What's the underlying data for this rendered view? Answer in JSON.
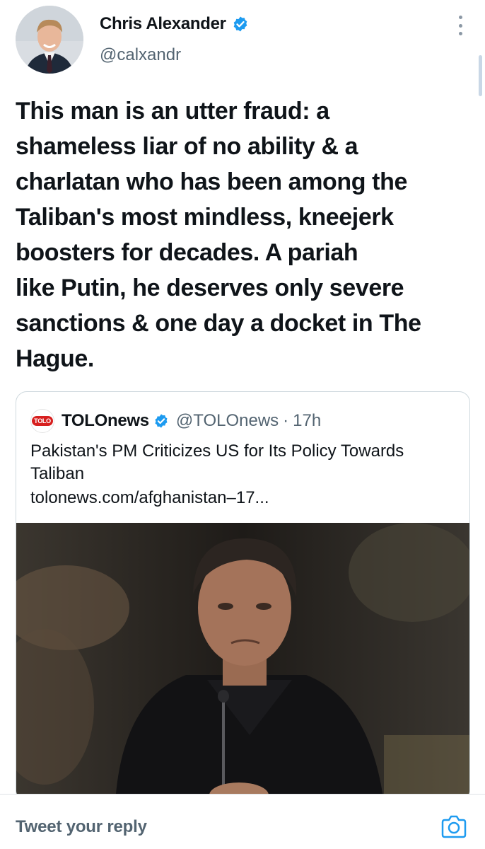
{
  "author": {
    "display_name": "Chris Alexander",
    "handle": "@calxandr"
  },
  "tweet": {
    "lines": [
      "This man is an utter fraud: a",
      "shameless liar of no ability & a",
      "charlatan who has been among the",
      "Taliban's most mindless, kneejerk",
      "boosters for decades. A pariah",
      "like Putin, he deserves only severe",
      "sanctions & one day a docket in The",
      "Hague."
    ]
  },
  "quoted_tweet": {
    "logo_text": "TOLO",
    "name": "TOLOnews",
    "handle": "@TOLOnews",
    "separator": "·",
    "time": "17h",
    "title_lines": [
      "Pakistan's PM Criticizes US for Its Policy Towards",
      "Taliban"
    ],
    "link": "tolonews.com/afghanistan–17..."
  },
  "reply": {
    "placeholder": "Tweet your reply"
  },
  "colors": {
    "verified_blue": "#1d9bf0",
    "secondary_text": "#536471",
    "tolo_red": "#d7201f"
  },
  "icons": [
    "verified-badge-icon",
    "more-options-icon",
    "camera-icon"
  ]
}
